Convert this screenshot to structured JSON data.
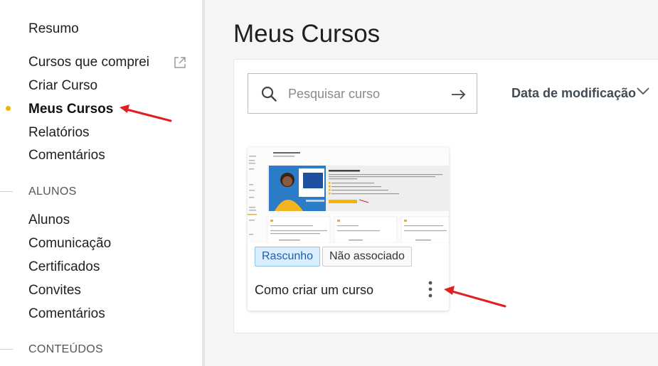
{
  "sidebar": {
    "items_top": [
      {
        "label": "Resumo"
      },
      {
        "label": "Cursos que comprei",
        "icon": "external-link-icon"
      },
      {
        "label": "Criar Curso"
      },
      {
        "label": "Meus Cursos",
        "active": true
      },
      {
        "label": "Relatórios"
      },
      {
        "label": "Comentários"
      }
    ],
    "section_alunos": {
      "label": "ALUNOS",
      "items": [
        {
          "label": "Alunos"
        },
        {
          "label": "Comunicação"
        },
        {
          "label": "Certificados"
        },
        {
          "label": "Convites"
        },
        {
          "label": "Comentários"
        }
      ]
    },
    "section_conteudos": {
      "label": "CONTEÚDOS"
    },
    "active_color": "#f6b400"
  },
  "main": {
    "title": "Meus Cursos",
    "search": {
      "placeholder": "Pesquisar curso",
      "value": ""
    },
    "sort": {
      "label": "Data de modificação"
    },
    "courses": [
      {
        "title": "Como criar um curso",
        "badges": [
          "Rascunho",
          "Não associado"
        ],
        "thumbnail": "course-preview-image"
      }
    ]
  },
  "annotations": {
    "arrow_color": "#e02020"
  }
}
